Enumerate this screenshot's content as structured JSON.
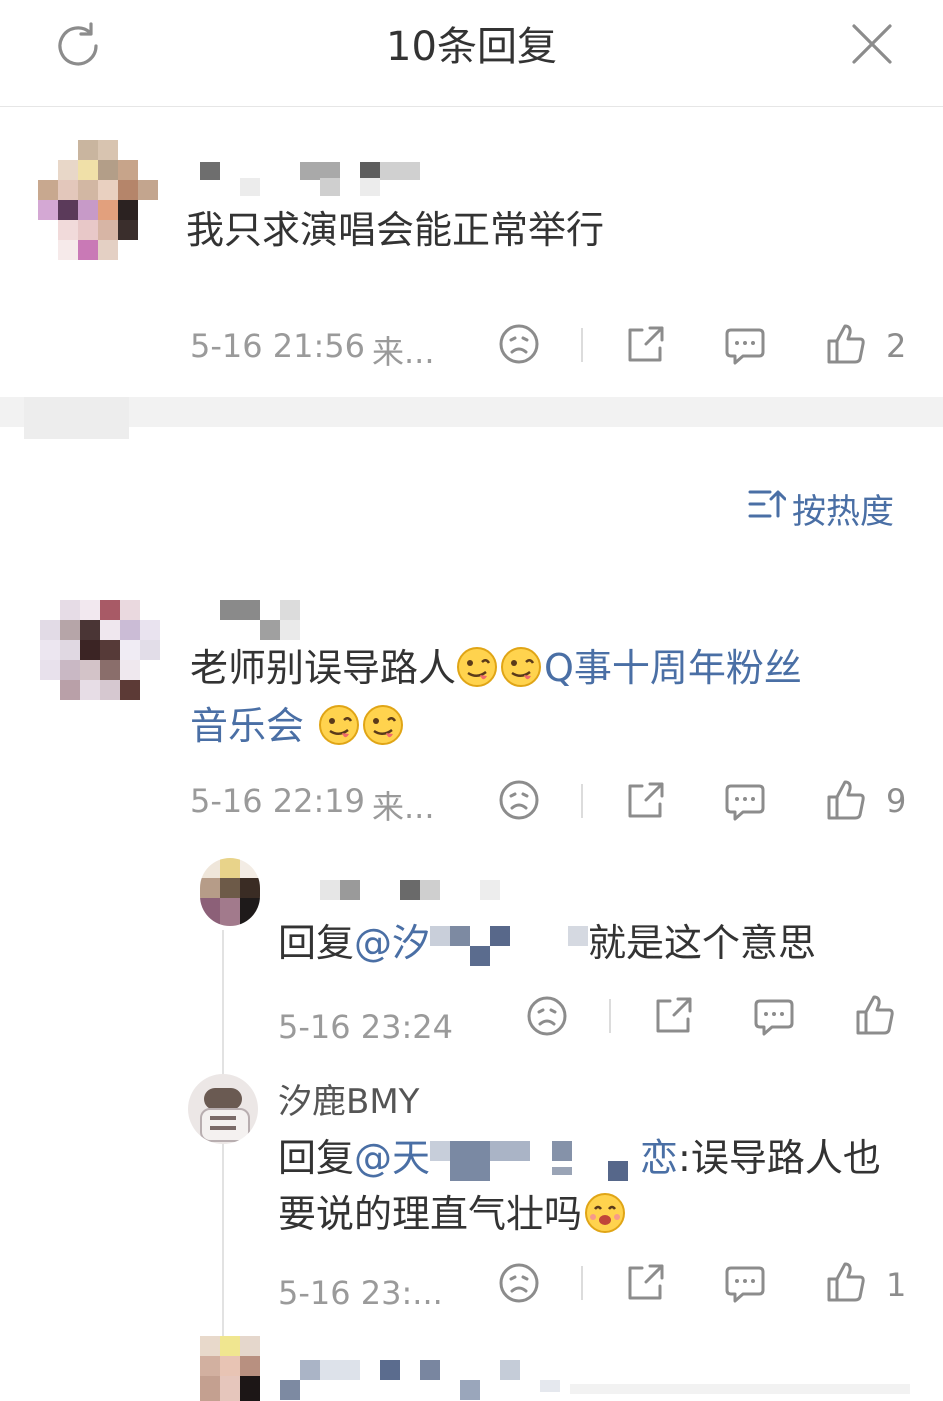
{
  "header": {
    "title": "10条回复",
    "refresh_icon": "refresh-icon",
    "close_icon": "close-icon"
  },
  "main_comment": {
    "text": "我只求演唱会能正常举行",
    "time": "5-16 21:56",
    "source": "来...",
    "likes": "2"
  },
  "sort": {
    "label": "按热度",
    "icon": "sort-icon"
  },
  "comment2": {
    "text_prefix": "老师别误导路人",
    "topic": "Q事十周年粉丝",
    "topic_cont": "音乐会",
    "time": "5-16 22:19",
    "source": "来...",
    "likes": "9"
  },
  "replies": [
    {
      "reply_prefix": "回复",
      "mention": "@汐",
      "text": "就是这个意思",
      "time": "5-16 23:24",
      "likes": ""
    },
    {
      "username": "汐鹿BMY",
      "reply_prefix": "回复",
      "mention": "@天",
      "mention_tail": "恋",
      "text": ":误导路人也",
      "text_line2": "要说的理直气壮吗",
      "time": "5-16 23:...",
      "likes": "1"
    }
  ],
  "colors": {
    "link": "#4a6fa5",
    "meta": "#9a9a9a",
    "icon": "#8c8c8c"
  }
}
